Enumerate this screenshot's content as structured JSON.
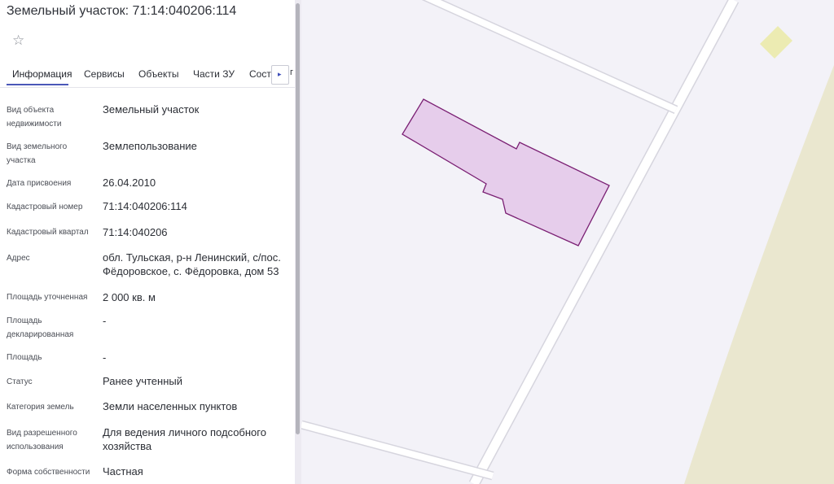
{
  "header": {
    "title": "Земельный участок: 71:14:040206:114",
    "favorite_icon": "star-icon"
  },
  "tabs": [
    {
      "label": "Информация",
      "active": true
    },
    {
      "label": "Сервисы",
      "active": false
    },
    {
      "label": "Объекты",
      "active": false
    },
    {
      "label": "Части ЗУ",
      "active": false
    },
    {
      "label": "Соста",
      "active": false
    }
  ],
  "tab_scroll": {
    "icon": "chevron-right-icon",
    "glyph": "▸",
    "tail": "г"
  },
  "info": {
    "rows": [
      {
        "label": "Вид объекта недвижимости",
        "value": "Земельный участок"
      },
      {
        "label": "Вид земельного участка",
        "value": "Землепользование"
      },
      {
        "label": "Дата присвоения",
        "value": "26.04.2010"
      },
      {
        "label": "Кадастровый номер",
        "value": "71:14:040206:114"
      },
      {
        "label": "Кадастровый квартал",
        "value": "71:14:040206"
      },
      {
        "label": "Адрес",
        "value": "обл. Тульская, р-н Ленинский, с/пос. Фёдоровское, с. Фёдоровка, дом 53"
      },
      {
        "label": "Площадь уточненная",
        "value": "2 000 кв. м"
      },
      {
        "label": "Площадь декларированная",
        "value": "-"
      },
      {
        "label": "Площадь",
        "value": "-"
      },
      {
        "label": "Статус",
        "value": "Ранее учтенный"
      },
      {
        "label": "Категория земель",
        "value": "Земли населенных пунктов"
      },
      {
        "label": "Вид разрешенного использования",
        "value": "Для ведения личного подсобного хозяйства"
      },
      {
        "label": "Форма собственности",
        "value": "Частная"
      }
    ]
  },
  "map": {
    "parcel_fill": "#e6cdeb",
    "parcel_stroke": "#7a1f73",
    "adjacent_fill": "#ecebb2",
    "road_color": "#ffffff",
    "background": "#f3f2f8",
    "terrain": "#eae7cf"
  }
}
